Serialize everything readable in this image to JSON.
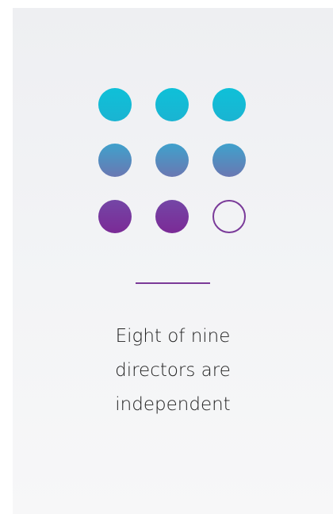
{
  "statistic": {
    "text_lines": [
      "Eight of nine",
      "directors are",
      "independent"
    ],
    "independent_directors": 8,
    "total_directors": 9
  },
  "colors": {
    "row1": "#14bdd6",
    "row2_top": "#3fa1cc",
    "row2_bottom": "#6a78b2",
    "row3_top": "#7446a6",
    "row3_bottom": "#7b2a96",
    "empty_dot_stroke": "#7a3a99",
    "divider": "#7b3a98"
  }
}
